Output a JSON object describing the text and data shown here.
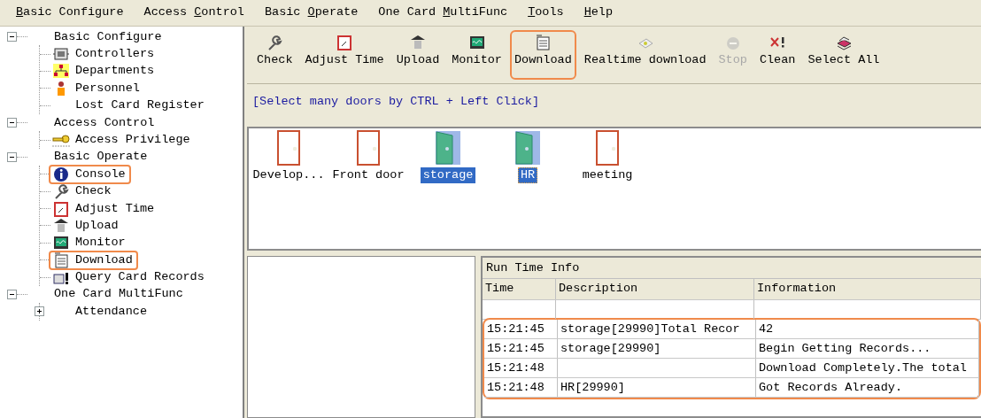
{
  "menu": [
    {
      "access_key": "B",
      "label_after": "asic Configure"
    },
    {
      "label_before": "Access ",
      "access_key": "C",
      "label_after": "ontrol"
    },
    {
      "label_before": "Basic ",
      "access_key": "O",
      "label_after": "perate"
    },
    {
      "label_before": "One Card ",
      "access_key": "M",
      "label_after": "ultiFunc"
    },
    {
      "access_key": "T",
      "label_after": "ools"
    },
    {
      "access_key": "H",
      "label_after": "elp"
    }
  ],
  "tree": [
    {
      "label": "Basic Configure",
      "expanded": true,
      "children": [
        {
          "label": "Controllers",
          "kind": "controllers",
          "highlighted": false
        },
        {
          "label": "Departments",
          "kind": "departments",
          "highlighted": false
        },
        {
          "label": "Personnel",
          "kind": "personnel",
          "highlighted": false
        },
        {
          "label": "Lost Card Register",
          "kind": "blank",
          "highlighted": false
        }
      ]
    },
    {
      "label": "Access Control",
      "expanded": true,
      "children": [
        {
          "label": "Access Privilege",
          "kind": "key",
          "highlighted": false
        }
      ]
    },
    {
      "label": "Basic Operate",
      "expanded": true,
      "children": [
        {
          "label": "Console",
          "kind": "info",
          "highlighted": true
        },
        {
          "label": "Check",
          "kind": "wrench",
          "highlighted": false
        },
        {
          "label": "Adjust Time",
          "kind": "clock",
          "highlighted": false
        },
        {
          "label": "Upload",
          "kind": "upload",
          "highlighted": false
        },
        {
          "label": "Monitor",
          "kind": "monitor",
          "highlighted": false
        },
        {
          "label": "Download",
          "kind": "download",
          "highlighted": true
        },
        {
          "label": "Query Card Records",
          "kind": "query",
          "highlighted": false
        }
      ]
    },
    {
      "label": "One Card MultiFunc",
      "expanded": true,
      "children": [
        {
          "label": "Attendance",
          "kind": "blank",
          "highlighted": false,
          "expanded": false
        }
      ]
    }
  ],
  "toolbar": [
    {
      "label": "Check",
      "kind": "wrench",
      "disabled": false,
      "highlighted": false
    },
    {
      "label": "Adjust Time",
      "kind": "clock",
      "disabled": false,
      "highlighted": false
    },
    {
      "label": "Upload",
      "kind": "upload",
      "disabled": false,
      "highlighted": false
    },
    {
      "label": "Monitor",
      "kind": "monitor",
      "disabled": false,
      "highlighted": false
    },
    {
      "label": "Download",
      "kind": "download",
      "disabled": false,
      "highlighted": true
    },
    {
      "label": "Realtime download",
      "kind": "realtime",
      "disabled": false,
      "highlighted": false
    },
    {
      "label": "Stop",
      "kind": "stop",
      "disabled": true,
      "highlighted": false
    },
    {
      "label": "Clean",
      "kind": "clean",
      "disabled": false,
      "highlighted": false
    },
    {
      "label": "Select All",
      "kind": "selectall",
      "disabled": false,
      "highlighted": false
    }
  ],
  "hint": "[Select many doors by CTRL + Left Click]",
  "doors": [
    {
      "name": "Develop...",
      "open": false,
      "selected": false,
      "focused": false
    },
    {
      "name": "Front door",
      "open": false,
      "selected": false,
      "focused": false
    },
    {
      "name": "storage",
      "open": true,
      "selected": true,
      "focused": false
    },
    {
      "name": "HR",
      "open": true,
      "selected": true,
      "focused": true
    },
    {
      "name": "meeting",
      "open": false,
      "selected": false,
      "focused": false
    }
  ],
  "run_time_info": {
    "title": "Run Time Info",
    "columns": [
      "Time",
      "Description",
      "Information"
    ],
    "rows": [
      {
        "cells": [
          "",
          "",
          ""
        ],
        "highlighted": false
      },
      {
        "cells": [
          "15:21:45",
          "storage[29990]Total Recor",
          "42"
        ],
        "highlighted": true
      },
      {
        "cells": [
          "15:21:45",
          "storage[29990]",
          "Begin Getting Records..."
        ],
        "highlighted": true
      },
      {
        "cells": [
          "15:21:48",
          "",
          "Download Completely.The total"
        ],
        "highlighted": true
      },
      {
        "cells": [
          "15:21:48",
          "HR[29990]",
          "Got Records Already."
        ],
        "highlighted": true
      }
    ]
  }
}
